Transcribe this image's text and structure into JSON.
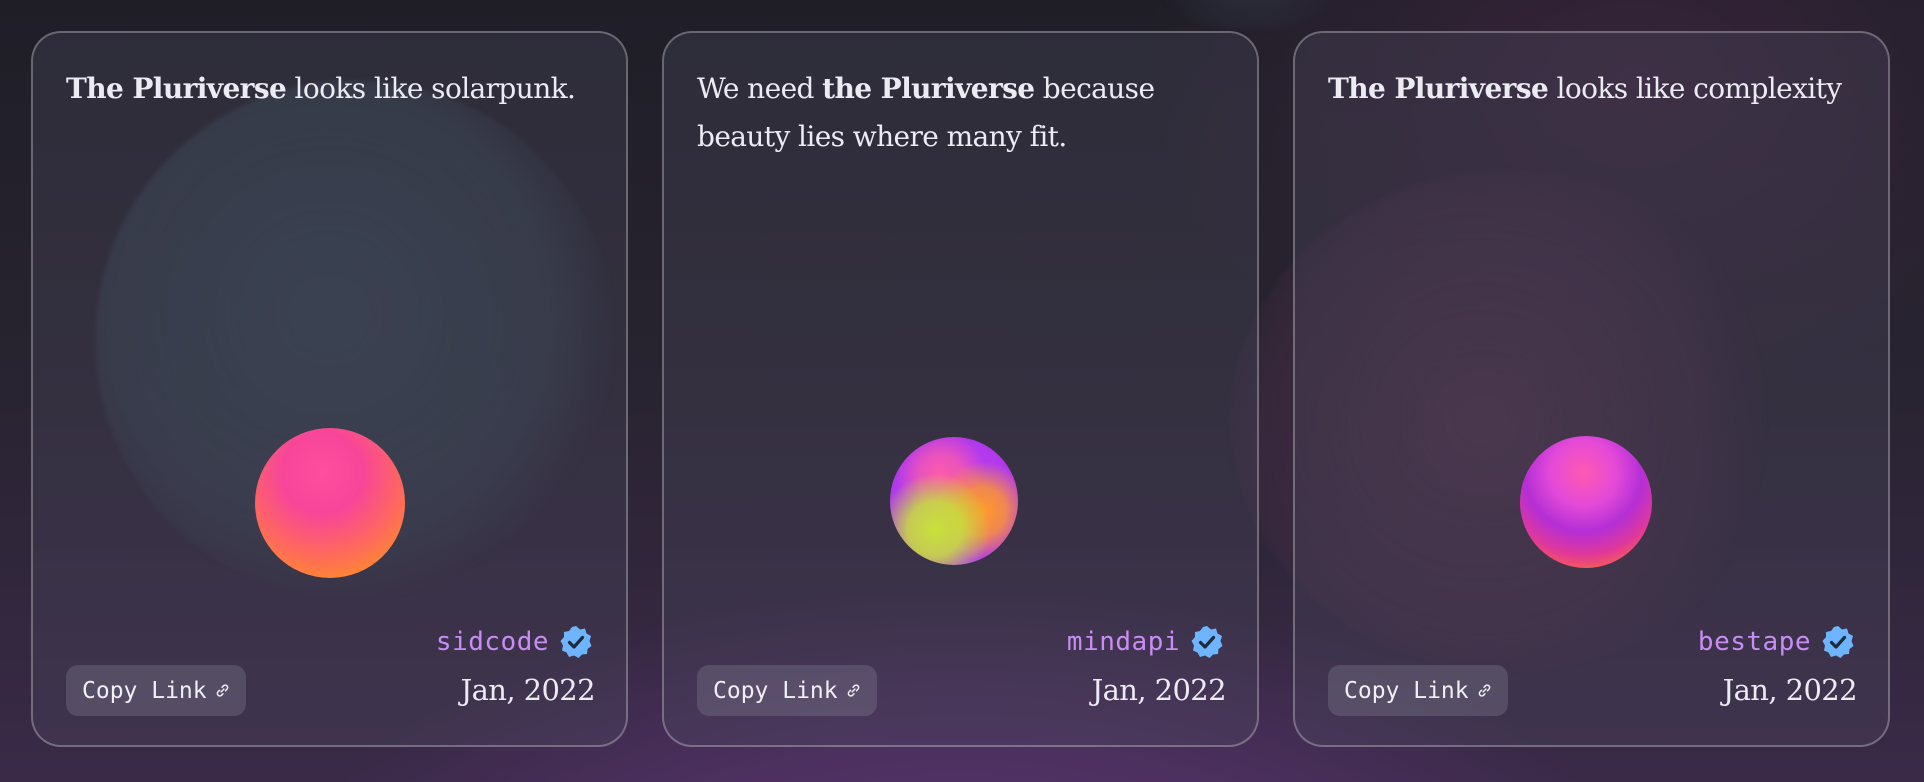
{
  "cards": [
    {
      "quote_prefix": "",
      "quote_bold": "The Pluriverse",
      "quote_suffix": " looks like solarpunk.",
      "username": "sidcode",
      "date": "Jan, 2022",
      "copy_label": "Copy Link",
      "orb_icon": "pink-orange-sphere",
      "verified_icon": "verified-badge-icon",
      "link_icon": "link-icon"
    },
    {
      "quote_prefix": "We need ",
      "quote_bold": "the Pluriverse",
      "quote_suffix": " because beauty lies where many fit.",
      "username": "mindapi",
      "date": "Jan, 2022",
      "copy_label": "Copy Link",
      "orb_icon": "purple-yellow-swirl-sphere",
      "verified_icon": "verified-badge-icon",
      "link_icon": "link-icon"
    },
    {
      "quote_prefix": "",
      "quote_bold": "The Pluriverse",
      "quote_suffix": " looks like complexity",
      "username": "bestape",
      "date": "Jan, 2022",
      "copy_label": "Copy Link",
      "orb_icon": "magenta-orange-sphere",
      "verified_icon": "verified-badge-icon",
      "link_icon": "link-icon"
    }
  ],
  "colors": {
    "username": "#c98cf5",
    "verified": "#6fb4ff",
    "text": "#eceaf2",
    "background": "#27232f"
  }
}
